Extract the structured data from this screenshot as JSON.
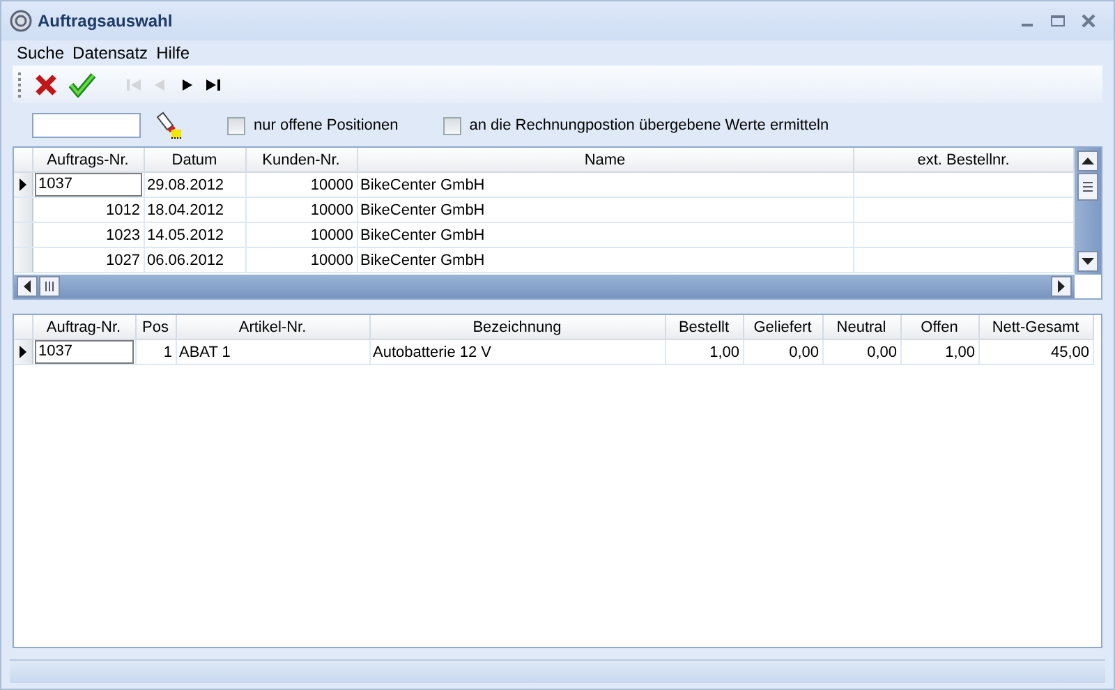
{
  "window": {
    "title": "Auftragsauswahl"
  },
  "menu": [
    "Suche",
    "Datensatz",
    "Hilfe"
  ],
  "toolbar": [
    {
      "kind": "cancel",
      "disabled": false
    },
    {
      "kind": "ok",
      "disabled": false
    },
    {
      "kind": "first",
      "disabled": true
    },
    {
      "kind": "prev",
      "disabled": true
    },
    {
      "kind": "next",
      "disabled": false
    },
    {
      "kind": "last",
      "disabled": false
    }
  ],
  "filter": {
    "checkboxes": [
      {
        "label": "nur offene Positionen",
        "checked": false
      },
      {
        "label": "an die Rechnungpostion übergebene Werte ermitteln",
        "checked": false
      }
    ]
  },
  "orders": {
    "columns": [
      {
        "label": "Auftrags-Nr."
      },
      {
        "label": "Datum"
      },
      {
        "label": "Kunden-Nr."
      },
      {
        "label": "Name"
      },
      {
        "label": "ext. Bestellnr."
      }
    ],
    "rows": [
      {
        "selected": true,
        "cells": [
          "1037",
          "29.08.2012",
          "10000",
          "BikeCenter GmbH",
          ""
        ]
      },
      {
        "selected": false,
        "cells": [
          "1012",
          "18.04.2012",
          "10000",
          "BikeCenter GmbH",
          ""
        ]
      },
      {
        "selected": false,
        "cells": [
          "1023",
          "14.05.2012",
          "10000",
          "BikeCenter GmbH",
          ""
        ]
      },
      {
        "selected": false,
        "cells": [
          "1027",
          "06.06.2012",
          "10000",
          "BikeCenter GmbH",
          ""
        ]
      }
    ]
  },
  "positions": {
    "columns": [
      {
        "label": "Auftrag-Nr."
      },
      {
        "label": "Pos"
      },
      {
        "label": "Artikel-Nr."
      },
      {
        "label": "Bezeichnung"
      },
      {
        "label": "Bestellt"
      },
      {
        "label": "Geliefert"
      },
      {
        "label": "Neutral"
      },
      {
        "label": "Offen"
      },
      {
        "label": "Nett-Gesamt"
      }
    ],
    "rows": [
      {
        "selected": true,
        "cells": [
          "1037",
          "1",
          "ABAT 1",
          "Autobatterie 12 V",
          "1,00",
          "0,00",
          "0,00",
          "1,00",
          "45,00"
        ]
      }
    ]
  }
}
